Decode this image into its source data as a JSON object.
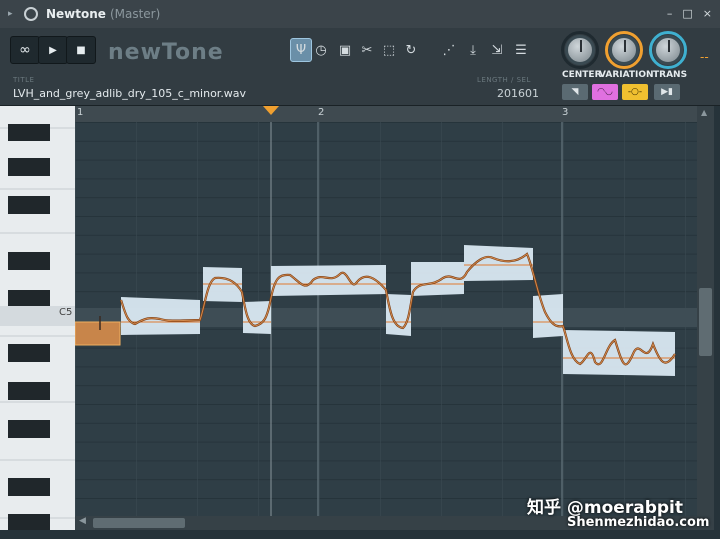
{
  "window": {
    "title": "Newtone",
    "subtitle": "(Master)",
    "buttons": [
      "–",
      "□",
      "×"
    ]
  },
  "transport": {
    "loop_icon": "loop-icon",
    "play_icon": "play-icon",
    "stop_icon": "stop-icon",
    "loop_symbol": "∞",
    "play_symbol": "▶",
    "stop_symbol": "■"
  },
  "logo": "newTone",
  "file": {
    "title_label": "TITLE",
    "name": "LVH_and_grey_adlib_dry_105_c_minor.wav",
    "length_label": "LENGTH / SEL",
    "length": "201601"
  },
  "knobs": [
    {
      "label": "CENTER",
      "ring": "#1f2a30"
    },
    {
      "label": "VARIATION",
      "ring": "#f0a030"
    },
    {
      "label": "TRANS",
      "ring": "#3fb0d0"
    }
  ],
  "modes": [
    {
      "symbol": "◥",
      "bg": "#5a6a72",
      "fg": "#e0e6e9"
    },
    {
      "symbol": "◠◡",
      "bg": "#e070e0",
      "fg": "#3a1a3a"
    },
    {
      "symbol": "-○-",
      "bg": "#f0c030",
      "fg": "#3a2a00"
    },
    {
      "symbol": "▶▮",
      "bg": "#5a6a72",
      "fg": "#e0e6e9"
    }
  ],
  "ruler": {
    "bars": [
      "1",
      "2",
      "3"
    ]
  },
  "piano": {
    "c_label": "C5"
  },
  "watermark": {
    "line1": "知乎 @moerabpit",
    "line2": "Shenmezhidao.com"
  },
  "colors": {
    "accent": "#f0a030",
    "note_fill": "#e8d2c0",
    "note_line": "#e07a30",
    "pitch": "#7a3a10"
  }
}
